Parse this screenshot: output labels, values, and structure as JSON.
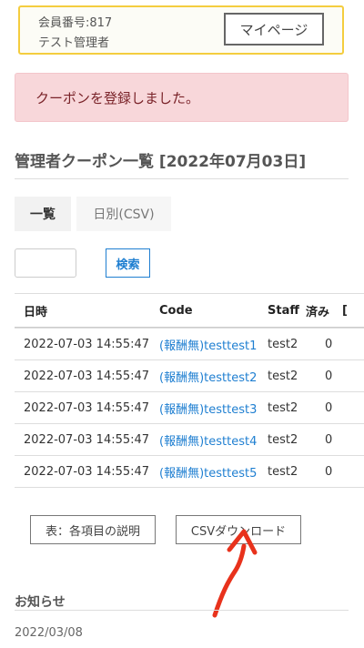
{
  "member": {
    "number": "会員番号:817",
    "name": "テスト管理者",
    "mypage_label": "マイページ"
  },
  "alert": {
    "message": "クーポンを登録しました。"
  },
  "page": {
    "title": "管理者クーポン一覧 [2022年07月03日]"
  },
  "tabs": [
    {
      "label": "一覧",
      "active": true
    },
    {
      "label": "日別(CSV)",
      "active": false
    }
  ],
  "search": {
    "value": "",
    "button_label": "検索"
  },
  "table": {
    "headers": [
      "日時",
      "Code",
      "Staff",
      "済み",
      "["
    ],
    "rows": [
      {
        "datetime": "2022-07-03 14:55:47",
        "code": "(報酬無)testtest1",
        "staff": "test2",
        "done": "0"
      },
      {
        "datetime": "2022-07-03 14:55:47",
        "code": "(報酬無)testtest2",
        "staff": "test2",
        "done": "0"
      },
      {
        "datetime": "2022-07-03 14:55:47",
        "code": "(報酬無)testtest3",
        "staff": "test2",
        "done": "0"
      },
      {
        "datetime": "2022-07-03 14:55:47",
        "code": "(報酬無)testtest4",
        "staff": "test2",
        "done": "0"
      },
      {
        "datetime": "2022-07-03 14:55:47",
        "code": "(報酬無)testtest5",
        "staff": "test2",
        "done": "0"
      }
    ]
  },
  "actions": {
    "description_label": "表：各項目の説明",
    "csv_download_label": "CSVダウンロード"
  },
  "news": {
    "title": "お知らせ",
    "date": "2022/03/08"
  },
  "annotation": {
    "arrow_color": "#e8321c"
  }
}
